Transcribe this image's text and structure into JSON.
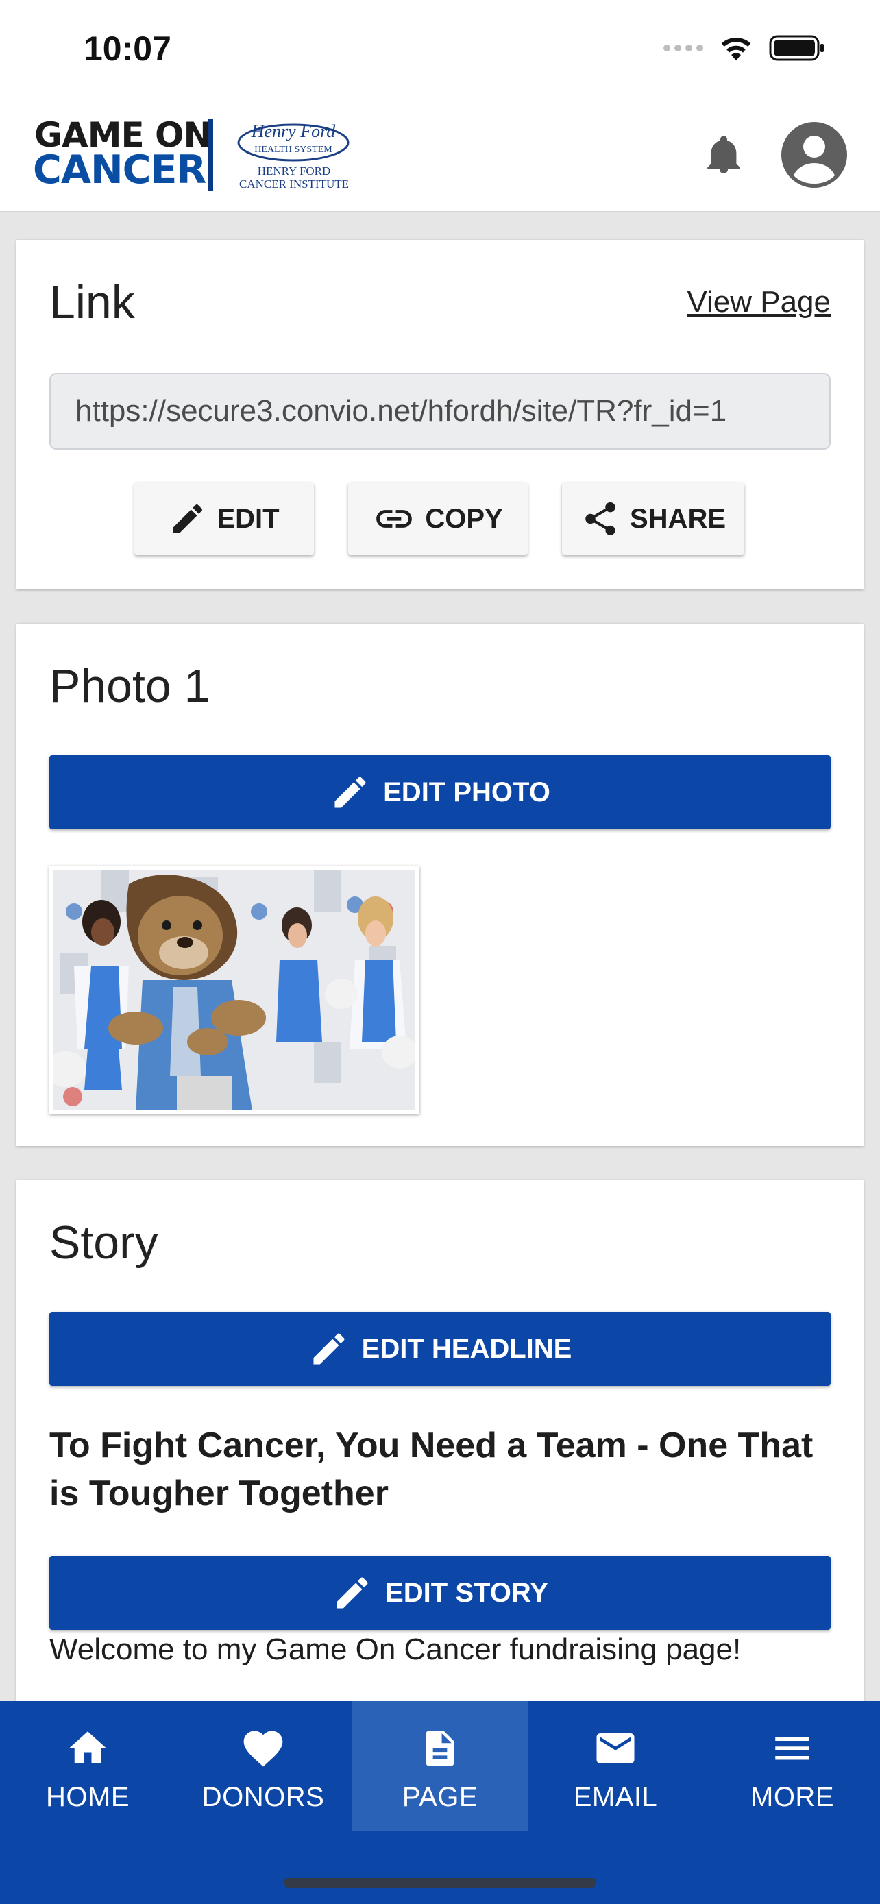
{
  "status_bar": {
    "time": "10:07"
  },
  "header": {
    "logo_line1": "GAME ON",
    "logo_line2": "CANCER",
    "partner_script": "Henry Ford",
    "partner_system": "HEALTH SYSTEM",
    "partner_line1": "HENRY FORD",
    "partner_line2": "CANCER INSTITUTE",
    "icons": [
      "bell-icon",
      "account-icon"
    ]
  },
  "link_card": {
    "title": "Link",
    "view_page_label": "View Page",
    "url_value": "https://secure3.convio.net/hfordh/site/TR?fr_id=1",
    "buttons": {
      "edit": "EDIT",
      "copy": "COPY",
      "share": "SHARE"
    }
  },
  "photo_card": {
    "title": "Photo 1",
    "edit_photo_label": "EDIT PHOTO"
  },
  "story_card": {
    "title": "Story",
    "edit_headline_label": "EDIT HEADLINE",
    "headline": "To Fight Cancer, You Need a Team - One That is Tougher Together",
    "edit_story_label": "EDIT STORY",
    "story_text": "Welcome to my Game On Cancer fundraising page!"
  },
  "bottom_nav": {
    "items": [
      {
        "label": "HOME",
        "icon": "home-icon"
      },
      {
        "label": "DONORS",
        "icon": "heart-icon"
      },
      {
        "label": "PAGE",
        "icon": "document-icon",
        "active": true
      },
      {
        "label": "EMAIL",
        "icon": "email-icon"
      },
      {
        "label": "MORE",
        "icon": "menu-icon"
      }
    ]
  },
  "colors": {
    "primary": "#0c47a8",
    "nav_active": "#2a62b8",
    "background": "#e6e6e6",
    "logo_blue": "#0a4ea3"
  }
}
